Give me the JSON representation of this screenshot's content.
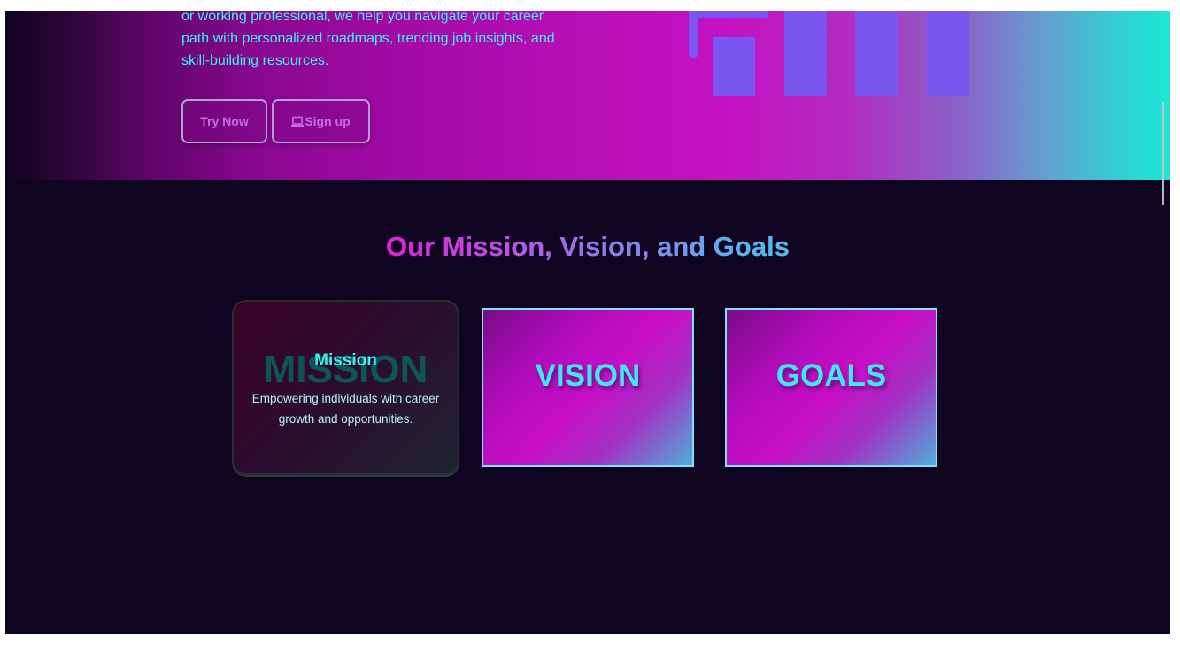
{
  "hero": {
    "lines": [
      "or working professional, we help you navigate your career",
      "path with personalized roadmaps, trending job insights, and",
      "skill-building resources."
    ],
    "buttons": {
      "try_now": "Try Now",
      "sign_up": "Sign up"
    }
  },
  "section": {
    "title": "Our Mission, Vision, and Goals"
  },
  "cards": {
    "mission": {
      "bg_word": "MISSION",
      "title": "Mission",
      "description": "Empowering individuals with career growth and opportunities."
    },
    "vision": {
      "label": "VISION"
    },
    "goals": {
      "label": "GOALS"
    }
  },
  "colors": {
    "page_background": "#100520",
    "accent_cyan": "#3ff0f0",
    "accent_magenta": "#c412c1",
    "deco_violet": "#7a55f0"
  },
  "icons": {
    "sign_up_icon": "laptop-icon"
  }
}
